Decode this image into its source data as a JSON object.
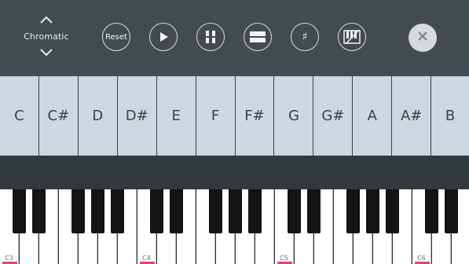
{
  "toolbar": {
    "scale_label": "Chromatic",
    "reset_label": "Reset",
    "icons": [
      "chevron-up-icon",
      "chevron-down-icon",
      "play-icon",
      "pause-icon",
      "wide-keys-icon",
      "sharp-icon",
      "keyboard-settings-icon",
      "close-icon"
    ],
    "sharp_symbol": "♯"
  },
  "notes": [
    "C",
    "C#",
    "D",
    "D#",
    "E",
    "F",
    "F#",
    "G",
    "G#",
    "A",
    "A#",
    "B"
  ],
  "keyboard": {
    "octave_labels": [
      "C3",
      "C4",
      "C5",
      "C6"
    ],
    "marker_color": "#e43d80"
  },
  "colors": {
    "toolbar_bg": "#434b4f",
    "note_cell_bg": "#d0d6e1",
    "background": "#323a3e"
  }
}
